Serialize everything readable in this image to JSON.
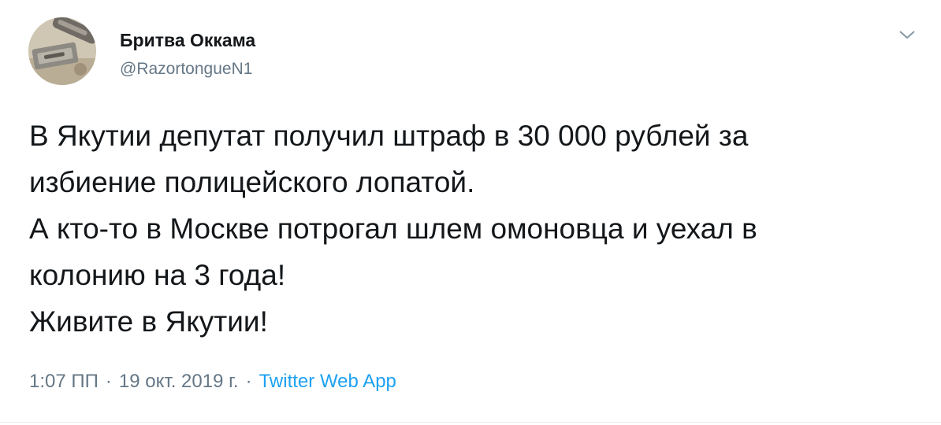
{
  "author": {
    "display_name": "Бритва Оккама",
    "handle": "@RazortongueN1",
    "avatar_icon": "razor-blade-avatar"
  },
  "menu": {
    "icon": "chevron-down-icon"
  },
  "tweet": {
    "lines": [
      "В Якутии депутат получил штраф в 30 000 рублей за",
      "избиение полицейского лопатой.",
      "А кто-то в Москве потрогал шлем омоновца и уехал в",
      "колонию на 3 года!",
      "Живите в Якутии!"
    ]
  },
  "meta": {
    "time": "1:07 ПП",
    "date": "19 окт. 2019 г.",
    "separator": "·",
    "source": "Twitter Web App"
  },
  "colors": {
    "text": "#14171a",
    "secondary": "#657786",
    "link": "#1da1f2",
    "divider": "#e6ecf0"
  }
}
